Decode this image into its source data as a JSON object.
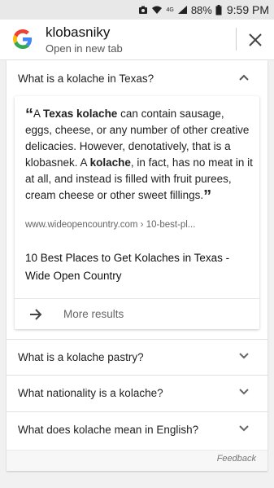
{
  "status_bar": {
    "battery_percent": "88%",
    "time": "9:59 PM",
    "network_label": "4G"
  },
  "header": {
    "query": "klobasniky",
    "subtitle": "Open in new tab"
  },
  "card": {
    "expanded_question": "What is a kolache in Texas?",
    "snippet": {
      "open_quote": "“",
      "part1": "A ",
      "bold1": "Texas kolache",
      "part2": " can contain sausage, eggs, cheese, or any number of other creative delicacies. However, denotatively, that is a klobasnek. A ",
      "bold2": "kolache",
      "part3": ", in fact, has no meat in it at all, and instead is filled with fruit purees, cream cheese or other sweet fillings.",
      "close_quote": "”"
    },
    "source_url": "www.wideopencountry.com › 10-best-pl...",
    "result_title": "10 Best Places to Get Kolaches in Texas - Wide Open Country",
    "more_results_label": "More results",
    "other_questions": [
      "What is a kolache pastry?",
      "What nationality is a kolache?",
      "What does kolache mean in English?"
    ],
    "feedback_label": "Feedback"
  },
  "colors": {
    "google_blue": "#4285F4",
    "google_red": "#EA4335",
    "google_yellow": "#FBBC05",
    "google_green": "#34A853"
  },
  "icons": [
    "camera-icon",
    "wifi-icon",
    "signal-icon",
    "battery-icon",
    "google-logo",
    "close-icon",
    "chevron-up-icon",
    "arrow-right-icon",
    "chevron-down-icon"
  ]
}
